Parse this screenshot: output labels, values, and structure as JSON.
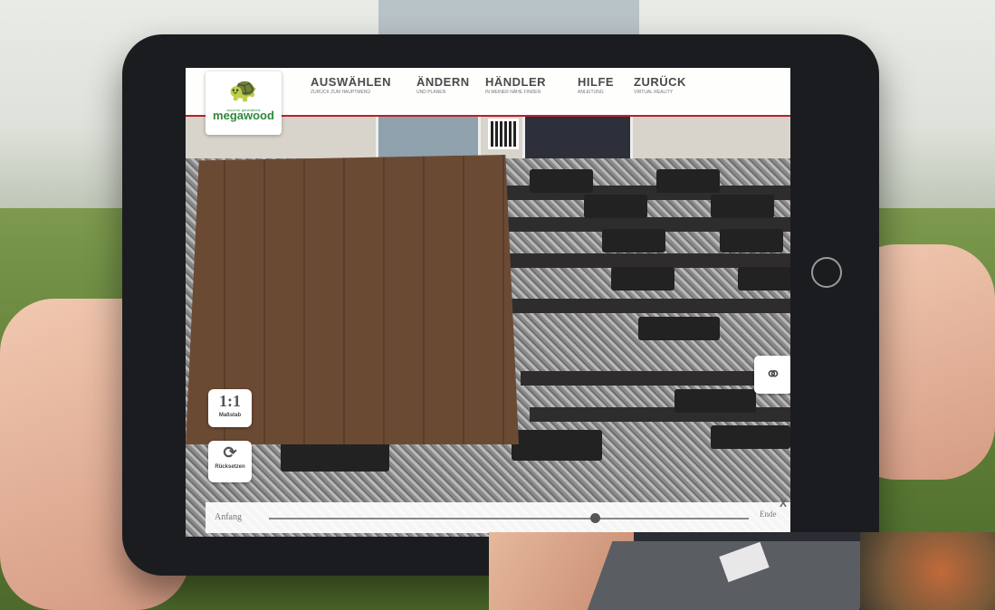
{
  "brand": {
    "name": "megawood",
    "tagline": "wood for generations",
    "accent": "#b9202c",
    "logo_green": "#2e8a3a"
  },
  "menu": {
    "items": [
      {
        "title": "AUSWÄHLEN",
        "subtitle": "ZURÜCK ZUM HAUPTMENÜ"
      },
      {
        "title": "ÄNDERN",
        "subtitle": "UND PLANEN"
      },
      {
        "title": "HÄNDLER",
        "subtitle": "IN MEINER NÄHE FINDEN"
      },
      {
        "title": "HILFE",
        "subtitle": "ANLEITUNG"
      },
      {
        "title": "ZURÜCK",
        "subtitle": "VIRTUAL REALITY"
      }
    ],
    "close": "x"
  },
  "tools": {
    "scale": {
      "value": "1:1",
      "label": "Maßstab"
    },
    "reset": {
      "icon": "refresh-icon",
      "label": "Rücksetzen"
    },
    "ar_icon": "link-icon"
  },
  "timeline": {
    "start_label": "Anfang",
    "end_label": "Ende",
    "progress": 0.68,
    "close": "X"
  }
}
